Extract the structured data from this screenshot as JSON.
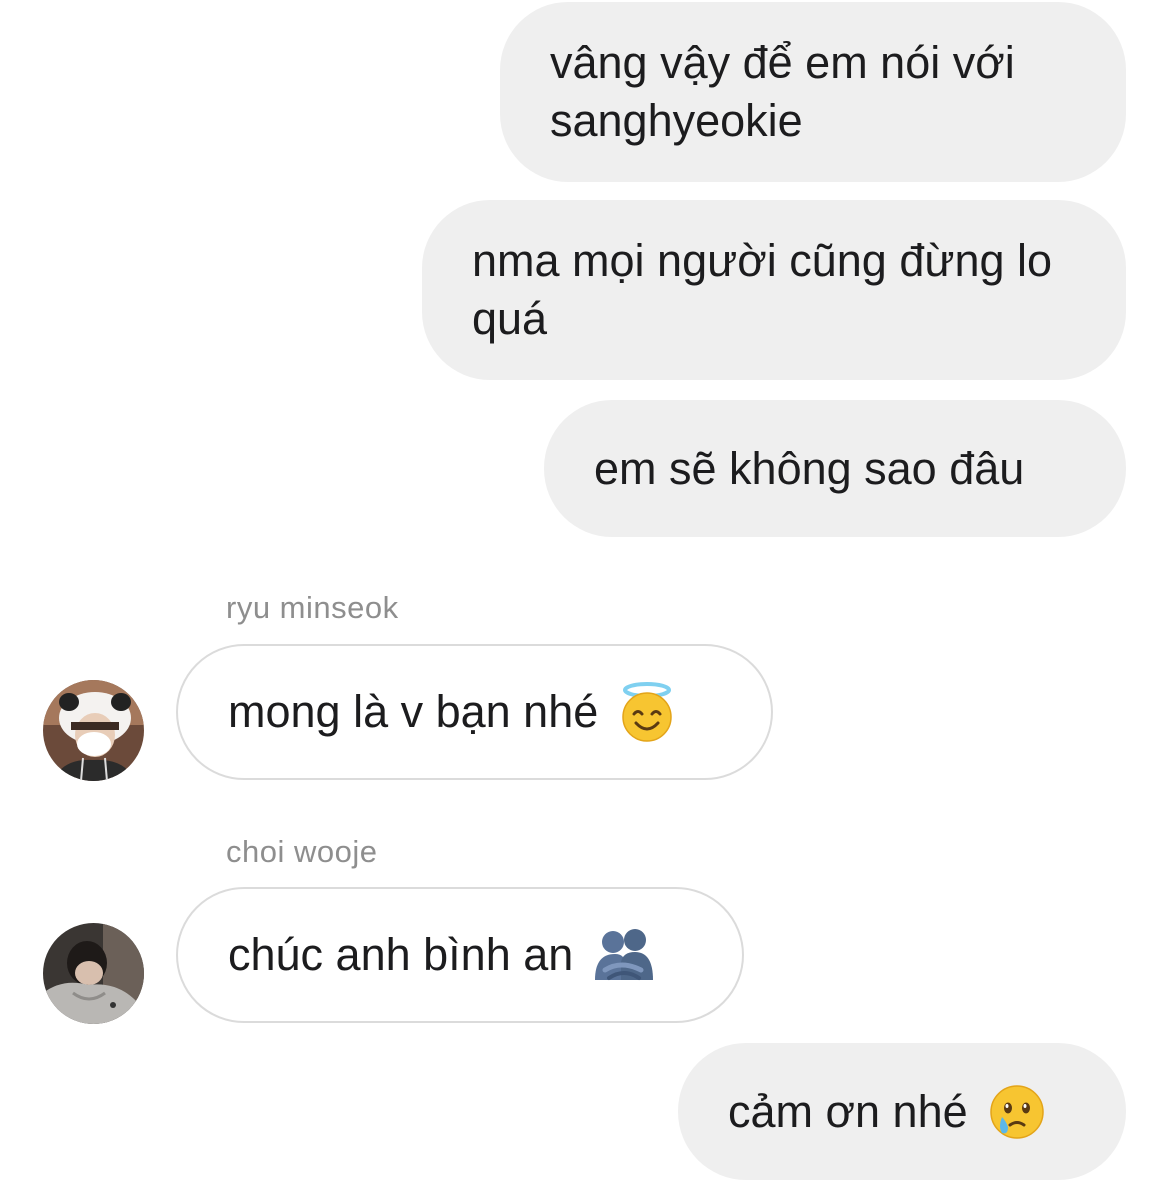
{
  "messages": [
    {
      "direction": "outgoing",
      "text": "vâng vậy để em nói với sanghyeokie"
    },
    {
      "direction": "outgoing",
      "text": "nma mọi người cũng đừng lo quá"
    },
    {
      "direction": "outgoing",
      "text": "em sẽ không sao đâu"
    },
    {
      "direction": "incoming",
      "sender": "ryu minseok",
      "text": "mong là v bạn nhé",
      "emoji": "smiling-face-with-halo-emoji"
    },
    {
      "direction": "incoming",
      "sender": "choi wooje",
      "text": "chúc anh bình an",
      "emoji": "people-hugging-emoji"
    },
    {
      "direction": "outgoing",
      "text": "cảm ơn nhé",
      "emoji": "face-holding-back-tears-emoji"
    }
  ],
  "colors": {
    "outgoing_bubble": "#efefef",
    "incoming_border": "#dbdbdb",
    "sender_name": "#8e8e8e",
    "text": "#1c1c1e"
  }
}
